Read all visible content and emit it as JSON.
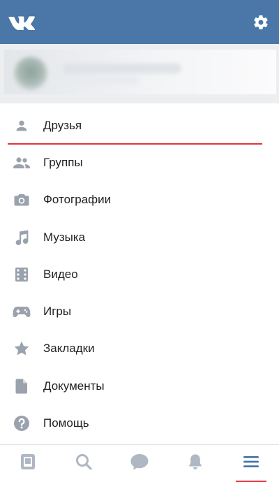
{
  "header": {
    "logo_icon": "vk-logo-icon",
    "settings_icon": "gear-icon",
    "background": "#4a76a8"
  },
  "menu": {
    "items": [
      {
        "label": "Друзья",
        "icon": "person-icon",
        "selected": true
      },
      {
        "label": "Группы",
        "icon": "people-icon"
      },
      {
        "label": "Фотографии",
        "icon": "camera-icon"
      },
      {
        "label": "Музыка",
        "icon": "music-note-icon"
      },
      {
        "label": "Видео",
        "icon": "film-icon"
      },
      {
        "label": "Игры",
        "icon": "gamepad-icon"
      },
      {
        "label": "Закладки",
        "icon": "star-icon"
      },
      {
        "label": "Документы",
        "icon": "document-icon"
      },
      {
        "label": "Помощь",
        "icon": "help-icon"
      }
    ]
  },
  "tabbar": {
    "tabs": [
      {
        "icon": "news-icon"
      },
      {
        "icon": "search-icon"
      },
      {
        "icon": "messages-icon"
      },
      {
        "icon": "bell-icon"
      },
      {
        "icon": "menu-icon",
        "active": true
      }
    ]
  },
  "colors": {
    "accent": "#4a76a8",
    "icon_gray": "#99a2ad",
    "highlight_red": "#e4323c"
  }
}
